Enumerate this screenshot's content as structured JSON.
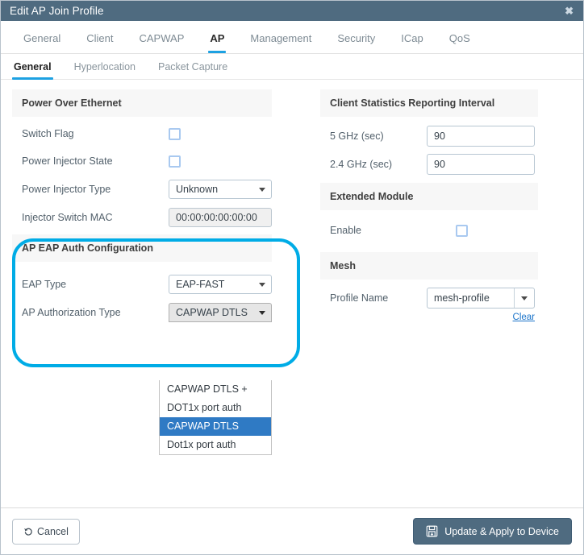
{
  "window": {
    "title": "Edit AP Join Profile",
    "close_icon": "close-icon",
    "titlebar_color": "#4f6b80"
  },
  "tabs": [
    {
      "label": "General",
      "active": false
    },
    {
      "label": "Client",
      "active": false
    },
    {
      "label": "CAPWAP",
      "active": false
    },
    {
      "label": "AP",
      "active": true
    },
    {
      "label": "Management",
      "active": false
    },
    {
      "label": "Security",
      "active": false
    },
    {
      "label": "ICap",
      "active": false
    },
    {
      "label": "QoS",
      "active": false
    }
  ],
  "subtabs": [
    {
      "label": "General",
      "active": true
    },
    {
      "label": "Hyperlocation",
      "active": false
    },
    {
      "label": "Packet Capture",
      "active": false
    }
  ],
  "left": {
    "poe": {
      "heading": "Power Over Ethernet",
      "switch_flag_label": "Switch Flag",
      "switch_flag_checked": false,
      "injector_state_label": "Power Injector State",
      "injector_state_checked": false,
      "injector_type_label": "Power Injector Type",
      "injector_type_value": "Unknown",
      "injector_mac_label": "Injector Switch MAC",
      "injector_mac_value": "00:00:00:00:00:00"
    },
    "eap": {
      "heading": "AP EAP Auth Configuration",
      "eap_type_label": "EAP Type",
      "eap_type_value": "EAP-FAST",
      "auth_type_label": "AP Authorization Type",
      "auth_type_value": "CAPWAP DTLS",
      "auth_type_options": [
        "CAPWAP DTLS +",
        "DOT1x port auth",
        "CAPWAP DTLS",
        "Dot1x port auth"
      ],
      "auth_type_selected_index": 2,
      "highlight_color": "#00ace6"
    }
  },
  "right": {
    "stats": {
      "heading": "Client Statistics Reporting Interval",
      "ghz5_label": "5 GHz (sec)",
      "ghz5_value": "90",
      "ghz24_label": "2.4 GHz (sec)",
      "ghz24_value": "90"
    },
    "extmod": {
      "heading": "Extended Module",
      "enable_label": "Enable",
      "enable_checked": false
    },
    "mesh": {
      "heading": "Mesh",
      "profile_label": "Profile Name",
      "profile_value": "mesh-profile",
      "clear_label": "Clear"
    }
  },
  "footer": {
    "cancel_label": "Cancel",
    "cancel_icon": "undo-arrow-icon",
    "update_label": "Update & Apply to Device",
    "update_icon": "save-disk-icon",
    "primary_color": "#4f6b80"
  }
}
